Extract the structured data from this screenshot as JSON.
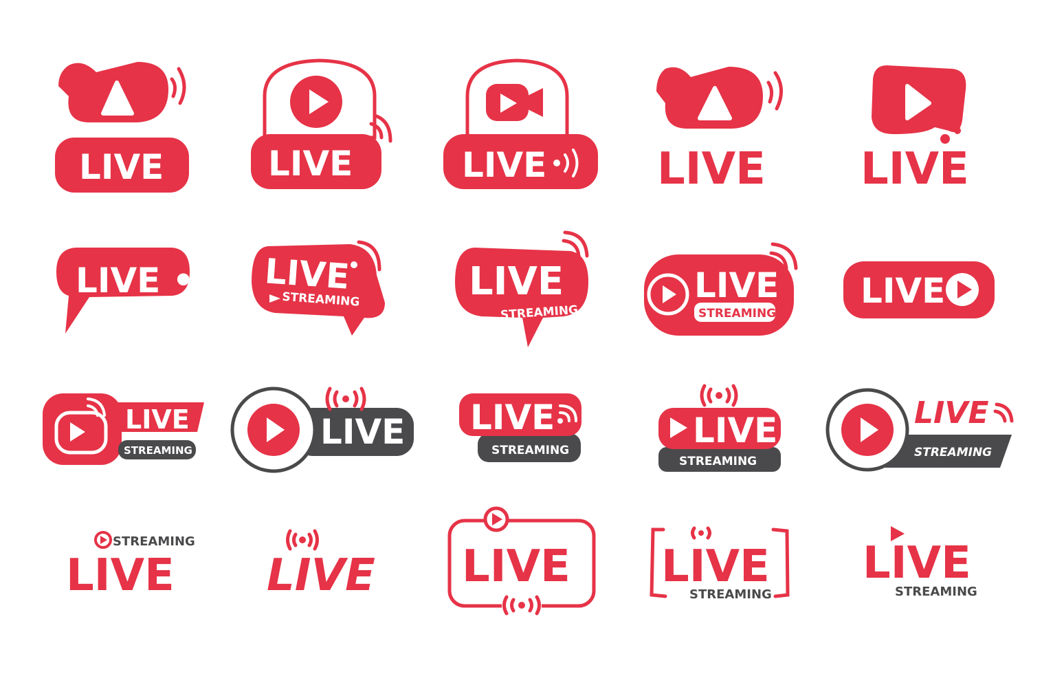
{
  "colors": {
    "accent": "#e63347",
    "dark": "#4a4a4c",
    "background": "#ffffff"
  },
  "badges": {
    "live": "LIVE",
    "streaming": "STREAMING",
    "live_dot": "LIVE •"
  },
  "icons": [
    "video-camera-icon",
    "play-icon",
    "broadcast-waves-icon",
    "speech-bubble-icon",
    "radio-signal-icon"
  ]
}
